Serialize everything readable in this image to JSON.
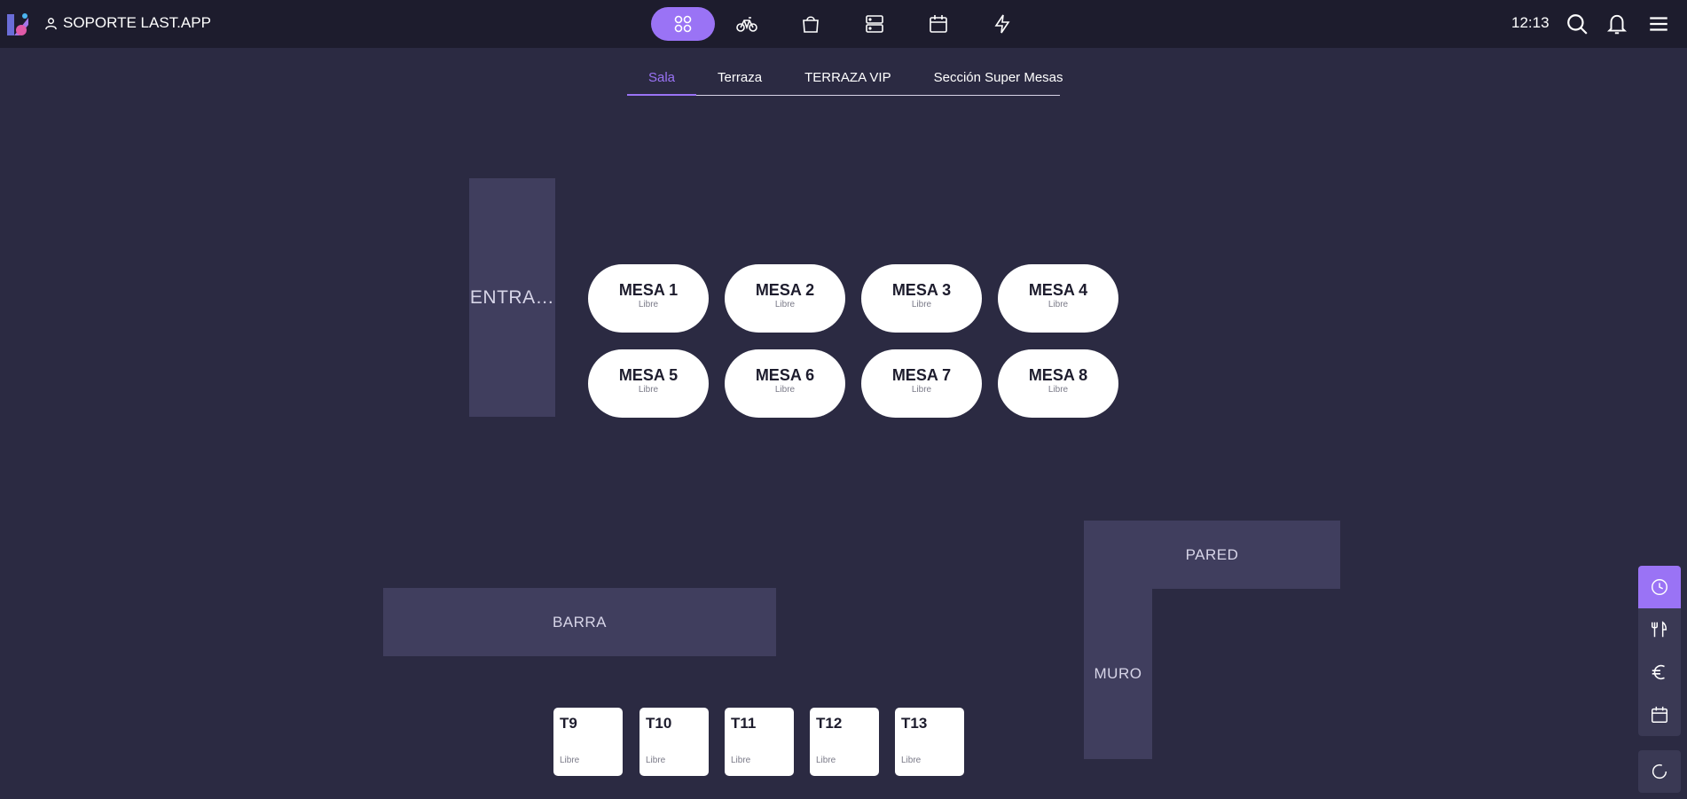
{
  "header": {
    "user_name": "SOPORTE LAST.APP",
    "time": "12:13",
    "nav_icons": [
      "tables-icon",
      "bicycle-icon",
      "bag-icon",
      "server-icon",
      "calendar-icon",
      "lightning-icon"
    ],
    "accent_color": "#9a73f5"
  },
  "tabs": [
    "Sala",
    "Terraza",
    "TERRAZA VIP",
    "Sección Super Mesas"
  ],
  "zones": {
    "entrance": "ENTRA…",
    "bar": "BARRA",
    "wall_top": "PARED",
    "wall_side": "MURO"
  },
  "round_tables": [
    {
      "name": "MESA 1",
      "status": "Libre"
    },
    {
      "name": "MESA 2",
      "status": "Libre"
    },
    {
      "name": "MESA 3",
      "status": "Libre"
    },
    {
      "name": "MESA 4",
      "status": "Libre"
    },
    {
      "name": "MESA 5",
      "status": "Libre"
    },
    {
      "name": "MESA 6",
      "status": "Libre"
    },
    {
      "name": "MESA 7",
      "status": "Libre"
    },
    {
      "name": "MESA 8",
      "status": "Libre"
    }
  ],
  "square_tables": [
    {
      "name": "T9",
      "status": "Libre"
    },
    {
      "name": "T10",
      "status": "Libre"
    },
    {
      "name": "T11",
      "status": "Libre"
    },
    {
      "name": "T12",
      "status": "Libre"
    },
    {
      "name": "T13",
      "status": "Libre"
    }
  ],
  "side_panel": [
    "clock-icon",
    "cutlery-icon",
    "euro-icon",
    "calendar-icon"
  ],
  "refresh_icon": "refresh-icon"
}
